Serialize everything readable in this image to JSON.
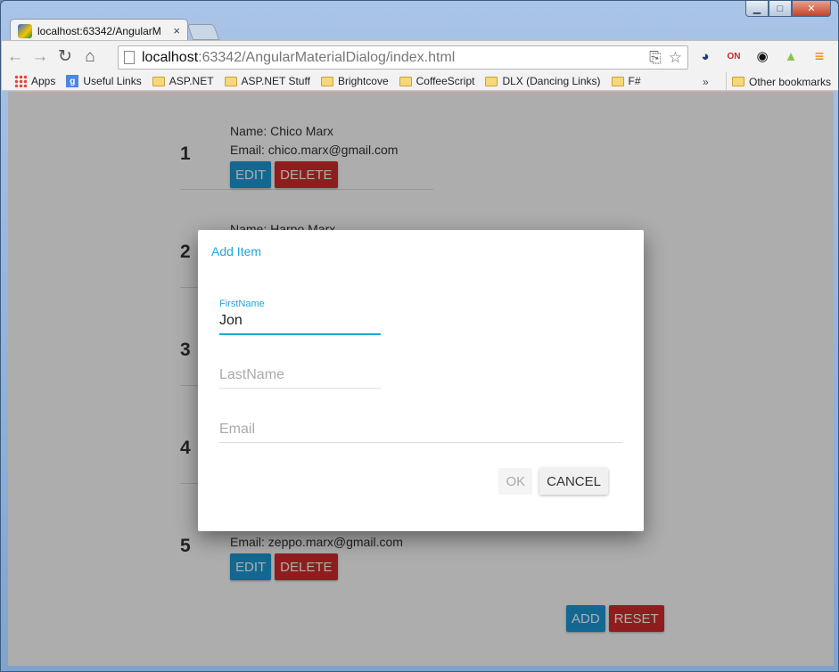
{
  "window": {
    "controls": {
      "minimize": "▁",
      "maximize": "□",
      "close": "✕"
    }
  },
  "tab": {
    "title": "localhost:63342/AngularM",
    "close": "×"
  },
  "omnibox": {
    "host": "localhost",
    "path": ":63342/AngularMaterialDialog/index.html"
  },
  "nav": {
    "back": "←",
    "forward": "→",
    "reload": "↻",
    "home": "⌂"
  },
  "extensions": [
    "page-action-icon",
    "star-icon",
    "speedometer-icon",
    "screencast-on-icon",
    "eye-icon",
    "android-icon",
    "menu-icon"
  ],
  "bookmarks": {
    "items": [
      {
        "label": "Apps",
        "icon": "apps-icon"
      },
      {
        "label": "Useful Links",
        "icon": "google-icon"
      },
      {
        "label": "ASP.NET",
        "icon": "folder-icon"
      },
      {
        "label": "ASP.NET Stuff",
        "icon": "folder-icon"
      },
      {
        "label": "Brightcove",
        "icon": "folder-icon"
      },
      {
        "label": "CoffeeScript",
        "icon": "folder-icon"
      },
      {
        "label": "DLX (Dancing Links)",
        "icon": "folder-icon"
      },
      {
        "label": "F#",
        "icon": "folder-icon"
      }
    ],
    "overflow": "»",
    "other": "Other bookmarks"
  },
  "list": {
    "rows": [
      {
        "num": "1",
        "name": "Name: Chico Marx",
        "email": "Email: chico.marx@gmail.com"
      },
      {
        "num": "2",
        "name": "Name: Harpo Marx",
        "email": ""
      },
      {
        "num": "3",
        "name": "",
        "email": ""
      },
      {
        "num": "4",
        "name": "",
        "email": ""
      },
      {
        "num": "5",
        "name": "",
        "email": "Email: zeppo.marx@gmail.com"
      }
    ],
    "edit_label": "EDIT",
    "delete_label": "DELETE"
  },
  "bottom": {
    "add_label": "ADD",
    "reset_label": "RESET"
  },
  "dialog": {
    "title": "Add Item",
    "first_name": {
      "label": "FirstName",
      "value": "Jon"
    },
    "last_name": {
      "placeholder": "LastName",
      "value": ""
    },
    "email": {
      "placeholder": "Email",
      "value": ""
    },
    "ok_label": "OK",
    "cancel_label": "CANCEL"
  },
  "colors": {
    "accent": "#1ea6dd",
    "edit": "#1c9ad6",
    "delete": "#d42b2b"
  }
}
